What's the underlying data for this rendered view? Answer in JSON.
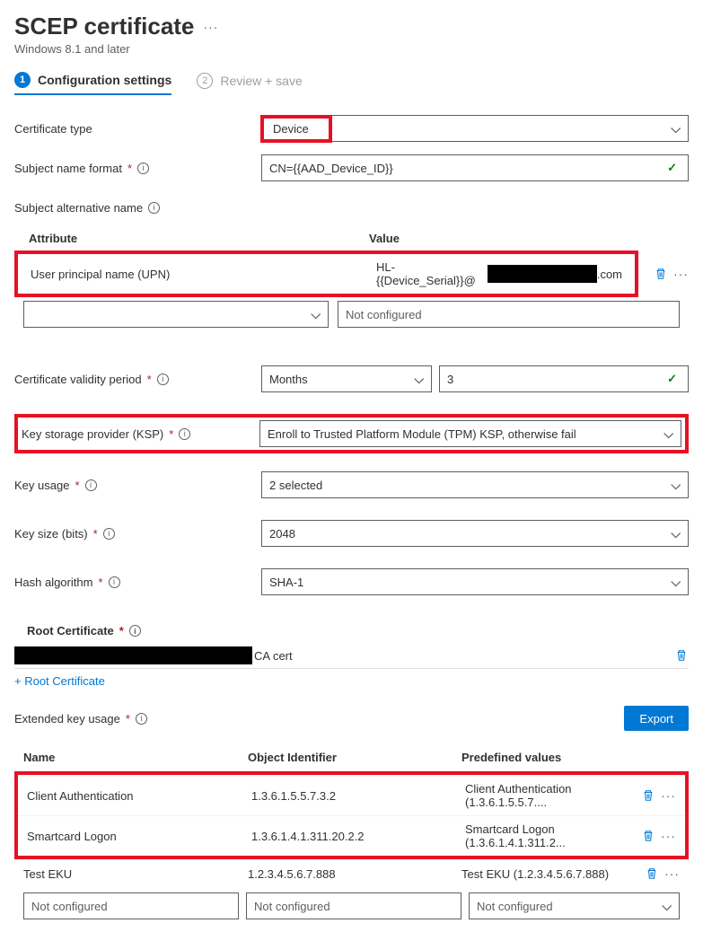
{
  "header": {
    "title": "SCEP certificate",
    "subtitle": "Windows 8.1 and later"
  },
  "steps": {
    "s1": {
      "num": "1",
      "label": "Configuration settings"
    },
    "s2": {
      "num": "2",
      "label": "Review + save"
    }
  },
  "cert_type": {
    "label": "Certificate type",
    "value": "Device"
  },
  "subject_name": {
    "label": "Subject name format",
    "value": "CN={{AAD_Device_ID}}"
  },
  "san": {
    "label": "Subject alternative name",
    "cols": {
      "attr": "Attribute",
      "val": "Value"
    },
    "row1": {
      "attr": "User principal name (UPN)",
      "val_prefix": "HL-{{Device_Serial}}@",
      "val_suffix": ".com"
    },
    "placeholder_val": "Not configured"
  },
  "validity": {
    "label": "Certificate validity period",
    "unit": "Months",
    "value": "3"
  },
  "ksp": {
    "label": "Key storage provider (KSP)",
    "value": "Enroll to Trusted Platform Module (TPM) KSP, otherwise fail"
  },
  "key_usage": {
    "label": "Key usage",
    "value": "2 selected"
  },
  "key_size": {
    "label": "Key size (bits)",
    "value": "2048"
  },
  "hash": {
    "label": "Hash algorithm",
    "value": "SHA-1"
  },
  "root_cert": {
    "label": "Root Certificate",
    "suffix": "CA cert",
    "add": "+ Root Certificate"
  },
  "eku": {
    "label": "Extended key usage",
    "export": "Export",
    "cols": {
      "name": "Name",
      "oid": "Object Identifier",
      "pred": "Predefined values"
    },
    "rows": [
      {
        "name": "Client Authentication",
        "oid": "1.3.6.1.5.5.7.3.2",
        "pred": "Client Authentication (1.3.6.1.5.5.7...."
      },
      {
        "name": "Smartcard Logon",
        "oid": "1.3.6.1.4.1.311.20.2.2",
        "pred": "Smartcard Logon (1.3.6.1.4.1.311.2..."
      },
      {
        "name": "Test EKU",
        "oid": "1.2.3.4.5.6.7.888",
        "pred": "Test EKU (1.2.3.4.5.6.7.888)"
      }
    ],
    "placeholder": "Not configured"
  }
}
